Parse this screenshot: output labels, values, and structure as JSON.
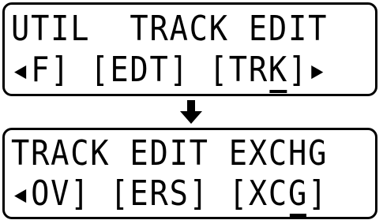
{
  "screen1": {
    "line1": "UTIL  TRACK EDIT",
    "line2_pre": "◂F] [EDT] [TR",
    "line2_cursor": "K",
    "line2_post": "]▸"
  },
  "arrow_icon": "arrow-down-icon",
  "screen2": {
    "line1": "TRACK EDIT EXCHG",
    "line2_pre": "◂OV] [ERS] [XC",
    "line2_cursor": "G",
    "line2_post": "]"
  }
}
